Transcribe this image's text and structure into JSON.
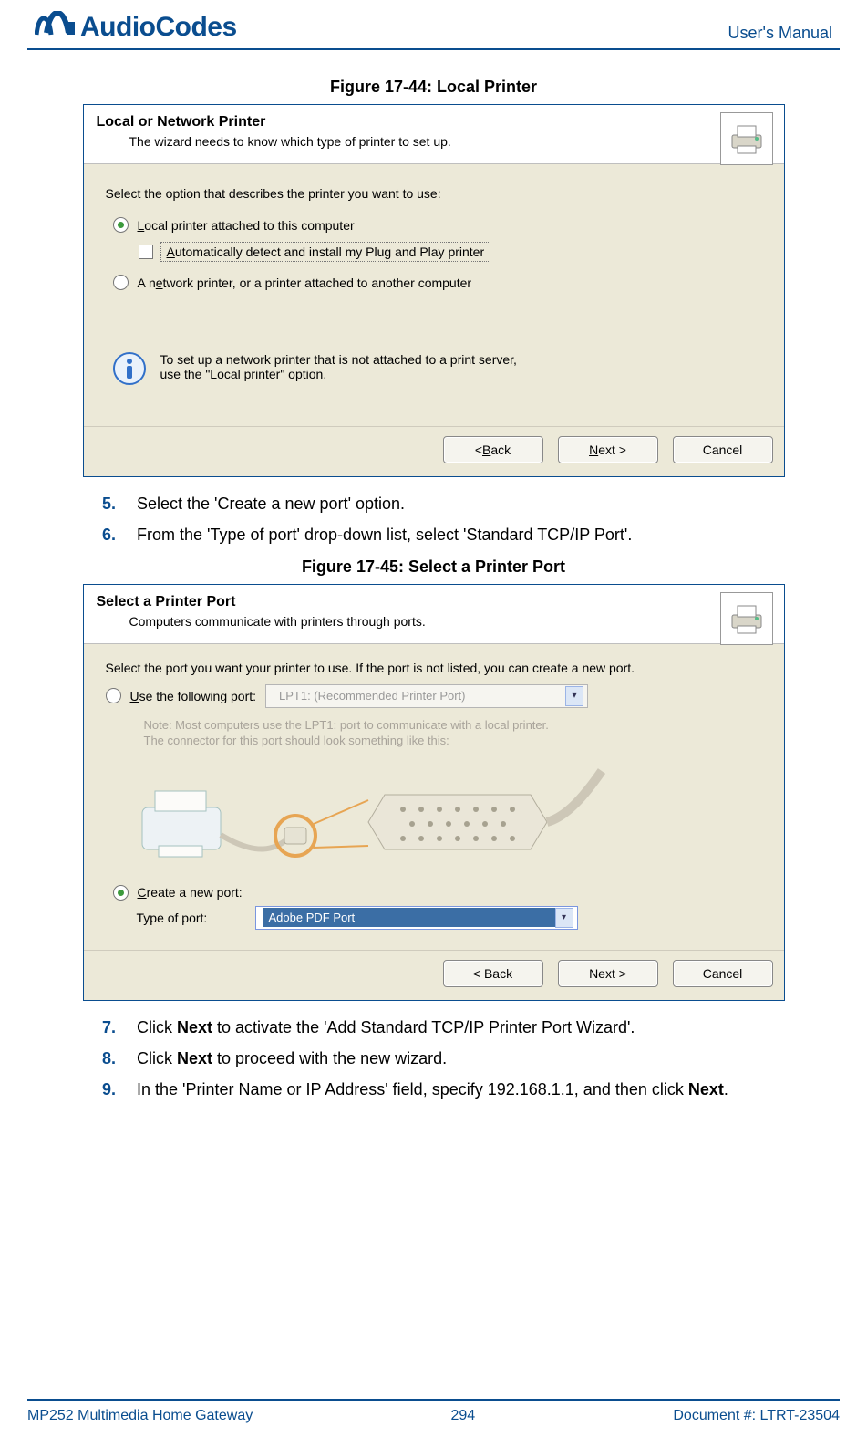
{
  "header": {
    "logo_text": "AudioCodes",
    "manual_label": "User's Manual"
  },
  "figure1": {
    "caption": "Figure 17-44: Local Printer",
    "panel_title": "Local or Network Printer",
    "panel_subtitle": "The wizard needs to know which type of printer to set up.",
    "intro": "Select the option that describes the printer you want to use:",
    "opt_local": "Local printer attached to this computer",
    "opt_auto": "Automatically detect and install my Plug and Play printer",
    "opt_network": "A network printer, or a printer attached to another computer",
    "info_text_1": "To set up a network printer that is not attached to a print server,",
    "info_text_2": "use the \"Local printer\" option.",
    "btn_back": "< Back",
    "btn_next": "Next >",
    "btn_cancel": "Cancel"
  },
  "steps_a": {
    "s5": "Select the 'Create a new port' option.",
    "s6": "From the 'Type of port' drop-down list, select 'Standard TCP/IP Port'."
  },
  "figure2": {
    "caption": "Figure 17-45: Select a Printer Port",
    "panel_title": "Select a Printer Port",
    "panel_subtitle": "Computers communicate with printers through ports.",
    "intro": "Select the port you want your printer to use.  If the port is not listed, you can create a new port.",
    "opt_use_existing": "Use the following port:",
    "existing_port_value": "LPT1: (Recommended Printer Port)",
    "note_line1": "Note: Most computers use the LPT1: port to communicate with a local printer.",
    "note_line2": "The connector for this port should look something like this:",
    "opt_create": "Create a new port:",
    "type_label": "Type of port:",
    "type_value": "Adobe PDF Port",
    "btn_back": "< Back",
    "btn_next": "Next >",
    "btn_cancel": "Cancel"
  },
  "steps_b": {
    "s7_pre": "Click ",
    "s7_bold": "Next",
    "s7_post": " to activate the 'Add Standard TCP/IP Printer Port Wizard'.",
    "s8_pre": "Click ",
    "s8_bold": "Next",
    "s8_post": " to proceed with the new wizard.",
    "s9_pre": "In the 'Printer Name or IP Address' field, specify 192.168.1.1, and then click ",
    "s9_bold": "Next",
    "s9_post": "."
  },
  "footer": {
    "left": "MP252 Multimedia Home Gateway",
    "center": "294",
    "right": "Document #: LTRT-23504"
  }
}
